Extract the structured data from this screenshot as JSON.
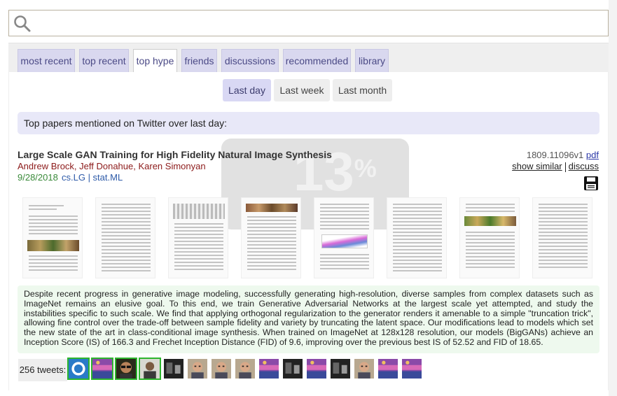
{
  "search": {
    "value": "",
    "placeholder": ""
  },
  "tabs": [
    {
      "label": "most recent",
      "active": false
    },
    {
      "label": "top recent",
      "active": false
    },
    {
      "label": "top hype",
      "active": true
    },
    {
      "label": "friends",
      "active": false
    },
    {
      "label": "discussions",
      "active": false
    },
    {
      "label": "recommended",
      "active": false
    },
    {
      "label": "library",
      "active": false
    }
  ],
  "time_filters": [
    {
      "label": "Last day",
      "active": true
    },
    {
      "label": "Last week",
      "active": false
    },
    {
      "label": "Last month",
      "active": false
    }
  ],
  "banner": "Top papers mentioned on Twitter over last day:",
  "paper": {
    "title": "Large Scale GAN Training for High Fidelity Natural Image Synthesis",
    "authors": "Andrew Brock, Jeff Donahue, Karen Simonyan",
    "date": "9/28/2018",
    "categories": "cs.LG | stat.ML",
    "arxiv_id": "1809.11096v1",
    "pdf_label": "pdf",
    "show_similar_label": "show similar",
    "discuss_label": "discuss",
    "abstract": "Despite recent progress in generative image modeling, successfully generating high-resolution, diverse samples from complex datasets such as ImageNet remains an elusive goal. To this end, we train Generative Adversarial Networks at the largest scale yet attempted, and study the instabilities specific to such scale. We find that applying orthogonal regularization to the generator renders it amenable to a simple \"truncation trick\", allowing fine control over the trade-off between sample fidelity and variety by truncating the latent space. Our modifications lead to models which set the new state of the art in class-conditional image synthesis. When trained on ImageNet at 128x128 resolution, our models (BigGANs) achieve an Inception Score (IS) of 166.3 and Frechet Inception Distance (FID) of 9.6, improving over the previous best IS of 52.52 and FID of 18.65.",
    "tweets_label": "256 tweets:"
  },
  "watermark": {
    "text": "13",
    "suffix": "%"
  },
  "colors": {
    "tab_bg": "#d9d8ef",
    "tab_text": "#4b4a86",
    "authors": "#8c1a1a",
    "date": "#3a8a3a",
    "categories": "#2d5aa8",
    "abstract_bg": "#eef9ee",
    "tweet_highlight": "#2db52d"
  },
  "tweet_avatars": [
    {
      "icon": "logo-avatar",
      "highlight": true
    },
    {
      "icon": "colorful-avatar",
      "highlight": true
    },
    {
      "icon": "sunglasses-avatar",
      "highlight": true
    },
    {
      "icon": "person-avatar",
      "highlight": true
    },
    {
      "icon": "dark-avatar",
      "highlight": false
    },
    {
      "icon": "face-avatar",
      "highlight": false
    },
    {
      "icon": "face-avatar",
      "highlight": false
    },
    {
      "icon": "face-avatar",
      "highlight": false
    },
    {
      "icon": "colorful-avatar",
      "highlight": false
    },
    {
      "icon": "dark-avatar",
      "highlight": false
    },
    {
      "icon": "colorful-avatar",
      "highlight": false
    },
    {
      "icon": "dark-avatar",
      "highlight": false
    },
    {
      "icon": "face-avatar",
      "highlight": false
    },
    {
      "icon": "colorful-avatar",
      "highlight": false
    },
    {
      "icon": "colorful-avatar",
      "highlight": false
    }
  ]
}
